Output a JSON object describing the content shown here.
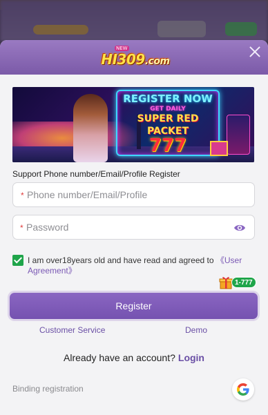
{
  "logo": {
    "text": "HI309",
    "domain": ".com",
    "badge": "NEW"
  },
  "banner": {
    "line1": "REGISTER NOW",
    "line2": "GET DAILY",
    "line3": "SUPER RED",
    "line4": "PACKET",
    "line5": "777"
  },
  "form": {
    "hint": "Support Phone number/Email/Profile Register",
    "phone_placeholder": "Phone number/Email/Profile",
    "password_placeholder": "Password",
    "required_mark": "*"
  },
  "agreement": {
    "text": "I am over18years old and have read and agreed to ",
    "link": "《User Agreement》",
    "checked": true
  },
  "register": {
    "label": "Register"
  },
  "promo": {
    "badge": "1-777"
  },
  "links": {
    "customer_service": "Customer Service",
    "demo": "Demo"
  },
  "account": {
    "prompt": "Already have an account?",
    "login": "Login"
  },
  "binding": {
    "label": "Binding registration"
  },
  "colors": {
    "accent": "#7552b0",
    "header": "#8b6ab8",
    "check": "#1fa54a",
    "link": "#6a4fa5"
  },
  "icons": {
    "close": "close-icon",
    "eye": "eye-icon",
    "check": "checkbox-checked-icon",
    "gift": "gift-icon",
    "google": "google-icon"
  }
}
